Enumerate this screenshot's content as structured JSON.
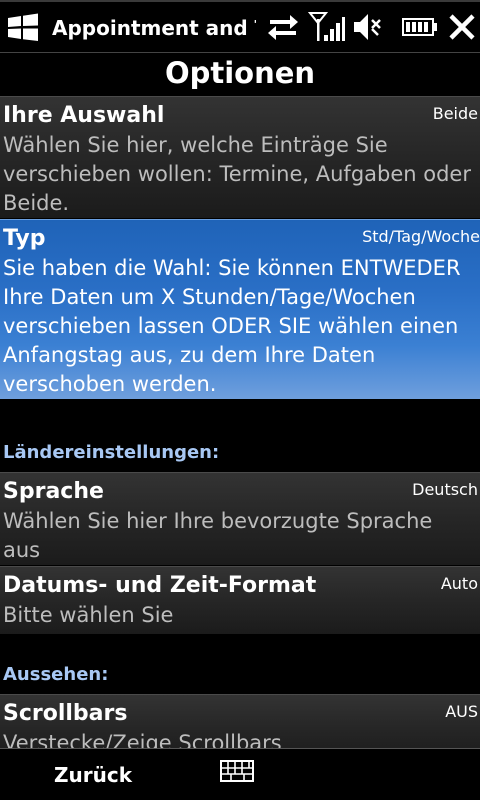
{
  "titlebar": {
    "app_title": "Appointment and Ta",
    "icons": [
      "windows-start-icon",
      "sync-arrows-icon",
      "signal-strength-icon",
      "speaker-muted-icon",
      "battery-icon",
      "close-icon"
    ]
  },
  "page": {
    "title": "Optionen"
  },
  "options": [
    {
      "title": "Ihre Auswahl",
      "value": "Beide",
      "desc": "Wählen Sie hier, welche Einträge Sie verschieben wollen:  Termine, Aufgaben oder Beide."
    },
    {
      "title": "Typ",
      "value": "Std/Tag/Woche",
      "desc": "Sie haben die Wahl: Sie können ENTWEDER Ihre Daten um X Stunden/Tage/Wochen verschieben lassen ODER SIE wählen einen Anfangstag aus, zu dem Ihre Daten verschoben werden."
    }
  ],
  "section_country": {
    "heading": "Ländereinstellungen:"
  },
  "country_options": [
    {
      "title": "Sprache",
      "value": "Deutsch",
      "desc": "Wählen Sie hier Ihre bevorzugte Sprache aus"
    },
    {
      "title": "Datums- und Zeit-Format",
      "value": "Auto",
      "desc": "Bitte wählen Sie"
    }
  ],
  "section_look": {
    "heading": "Aussehen:"
  },
  "look_options": [
    {
      "title": "Scrollbars",
      "value": "AUS",
      "desc": "Verstecke/Zeige Scrollbars"
    }
  ],
  "softbar": {
    "left_label": "Zurück",
    "center_icon": "keyboard-icon"
  },
  "colors": {
    "selection": "#2a6fc6",
    "section_heading": "#a8c8f4",
    "desc_text": "#bdbdbd"
  }
}
